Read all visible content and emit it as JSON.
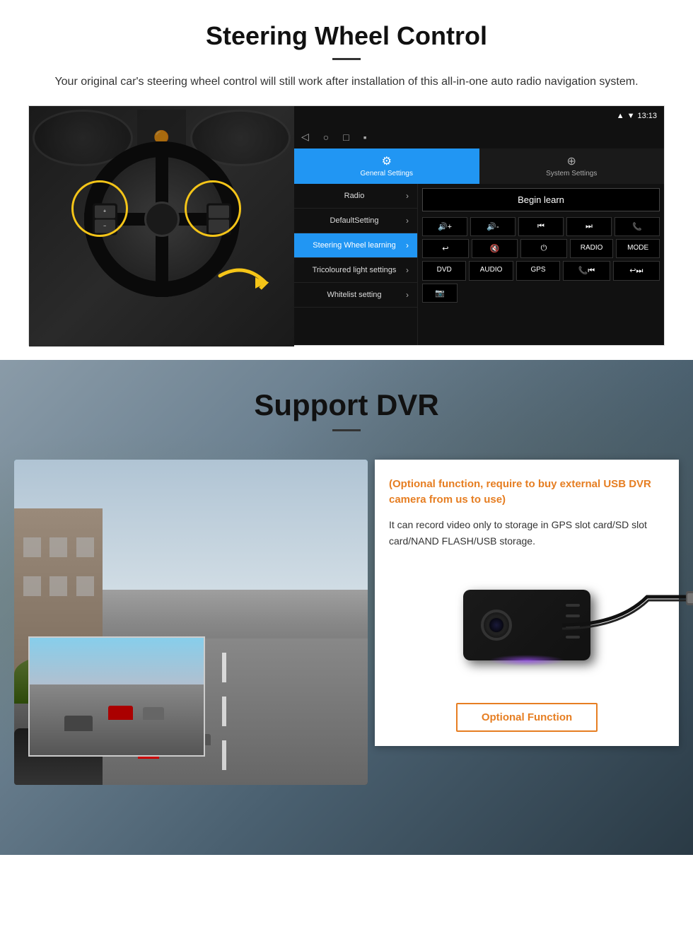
{
  "steering_section": {
    "title": "Steering Wheel Control",
    "description": "Your original car's steering wheel control will still work after installation of this all-in-one auto radio navigation system.",
    "android_ui": {
      "status_time": "13:13",
      "tab_general": "General Settings",
      "tab_system": "System Settings",
      "menu_items": [
        {
          "label": "Radio",
          "active": false
        },
        {
          "label": "DefaultSetting",
          "active": false
        },
        {
          "label": "Steering Wheel learning",
          "active": true
        },
        {
          "label": "Tricoloured light settings",
          "active": false
        },
        {
          "label": "Whitelist setting",
          "active": false
        }
      ],
      "begin_learn": "Begin learn",
      "control_buttons": [
        [
          "🔊+",
          "🔊-",
          "⏮",
          "⏭",
          "📞"
        ],
        [
          "↩",
          "🔇",
          "⏻",
          "RADIO",
          "MODE"
        ],
        [
          "DVD",
          "AUDIO",
          "GPS",
          "📞⏮",
          "↩⏭"
        ],
        [
          "📷"
        ]
      ]
    }
  },
  "dvr_section": {
    "title": "Support DVR",
    "optional_text": "(Optional function, require to buy external USB DVR camera from us to use)",
    "description": "It can record video only to storage in GPS slot card/SD slot card/NAND FLASH/USB storage.",
    "optional_button": "Optional Function"
  }
}
